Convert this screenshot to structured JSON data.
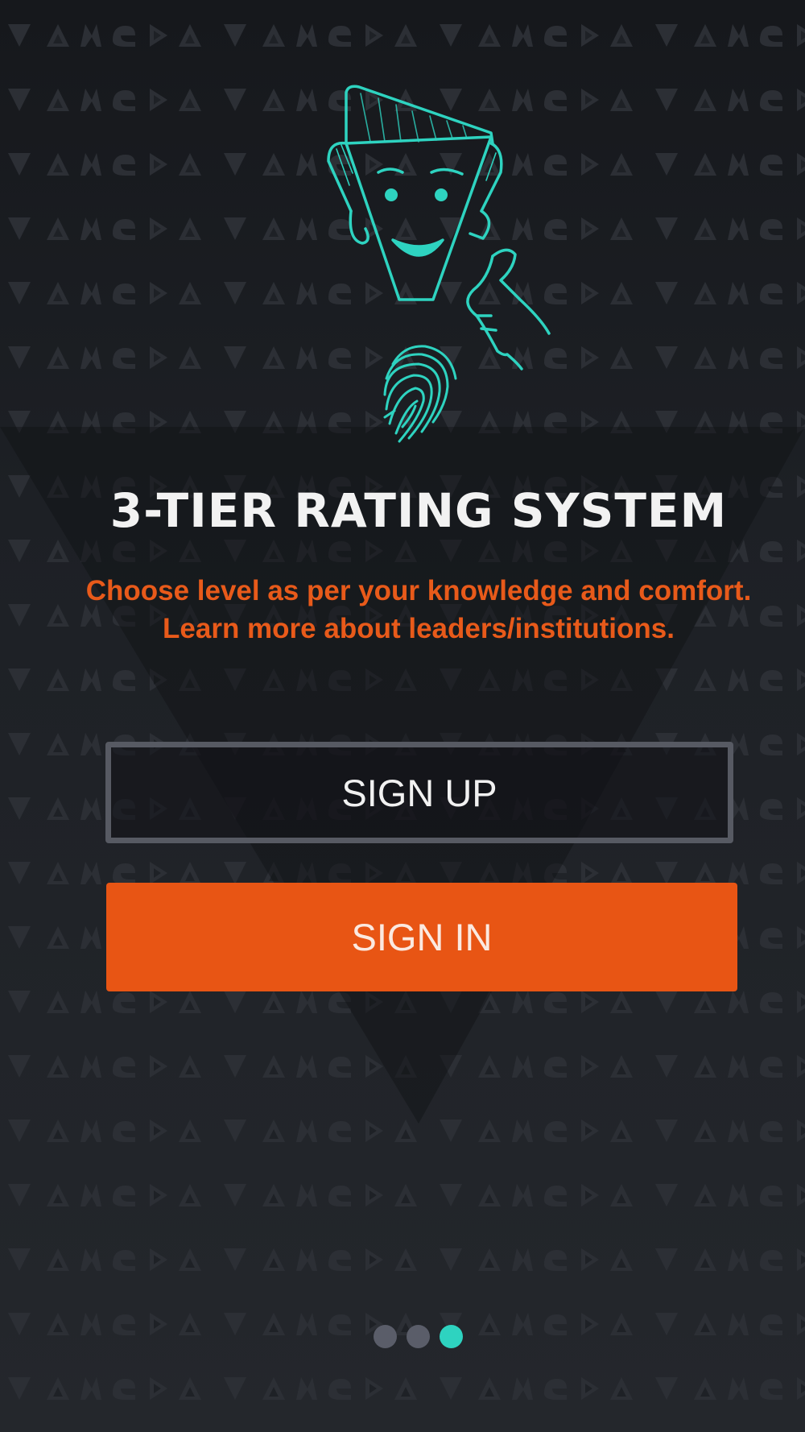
{
  "onboarding": {
    "title": "3-TIER RATING SYSTEM",
    "subtitle_line1": "Choose level as per your knowledge and comfort.",
    "subtitle_line2": "Learn more about leaders/institutions.",
    "illustration_icon": "thumbs-up-character-with-fingerprint"
  },
  "actions": {
    "signup_label": "SIGN UP",
    "signin_label": "SIGN IN"
  },
  "pagination": {
    "total_pages": 3,
    "active_page": 3
  },
  "colors": {
    "background": "#1f2227",
    "accent_teal": "#2ed3c0",
    "accent_orange": "#e85514",
    "title_text": "#f2f2f2",
    "button_border": "#575a63",
    "inactive_dot": "#5a5d69"
  }
}
